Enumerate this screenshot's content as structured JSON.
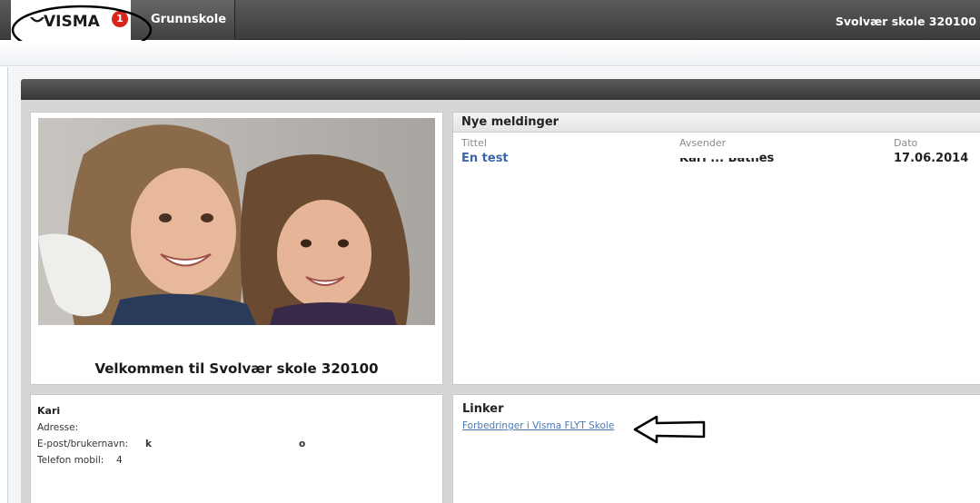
{
  "header": {
    "logo_text": "VISMA",
    "notification_count": "1",
    "app_name": "Grunnskole",
    "school": "Svolvær skole 320100"
  },
  "welcome": {
    "text": "Velkommen til Svolvær skole 320100"
  },
  "messages": {
    "title": "Nye meldinger",
    "columns": [
      "Tittel",
      "Avsender",
      "Dato"
    ],
    "rows": [
      {
        "title": "En test",
        "sender": "Kari ... Båtnes",
        "date": "17.06.2014"
      }
    ]
  },
  "user": {
    "name": "Kari",
    "address_label": "Adresse:",
    "email_label": "E-post/brukernavn:",
    "phone_label": "Telefon mobil:",
    "email_value_fragment": "k",
    "email_value_end": "o",
    "phone_value_fragment": "4"
  },
  "links": {
    "title": "Linker",
    "items": [
      "Forbedringer i Visma FLYT Skole"
    ]
  },
  "colors": {
    "topbar": "#404040",
    "link": "#4a78b5",
    "badge": "#d9261c"
  }
}
